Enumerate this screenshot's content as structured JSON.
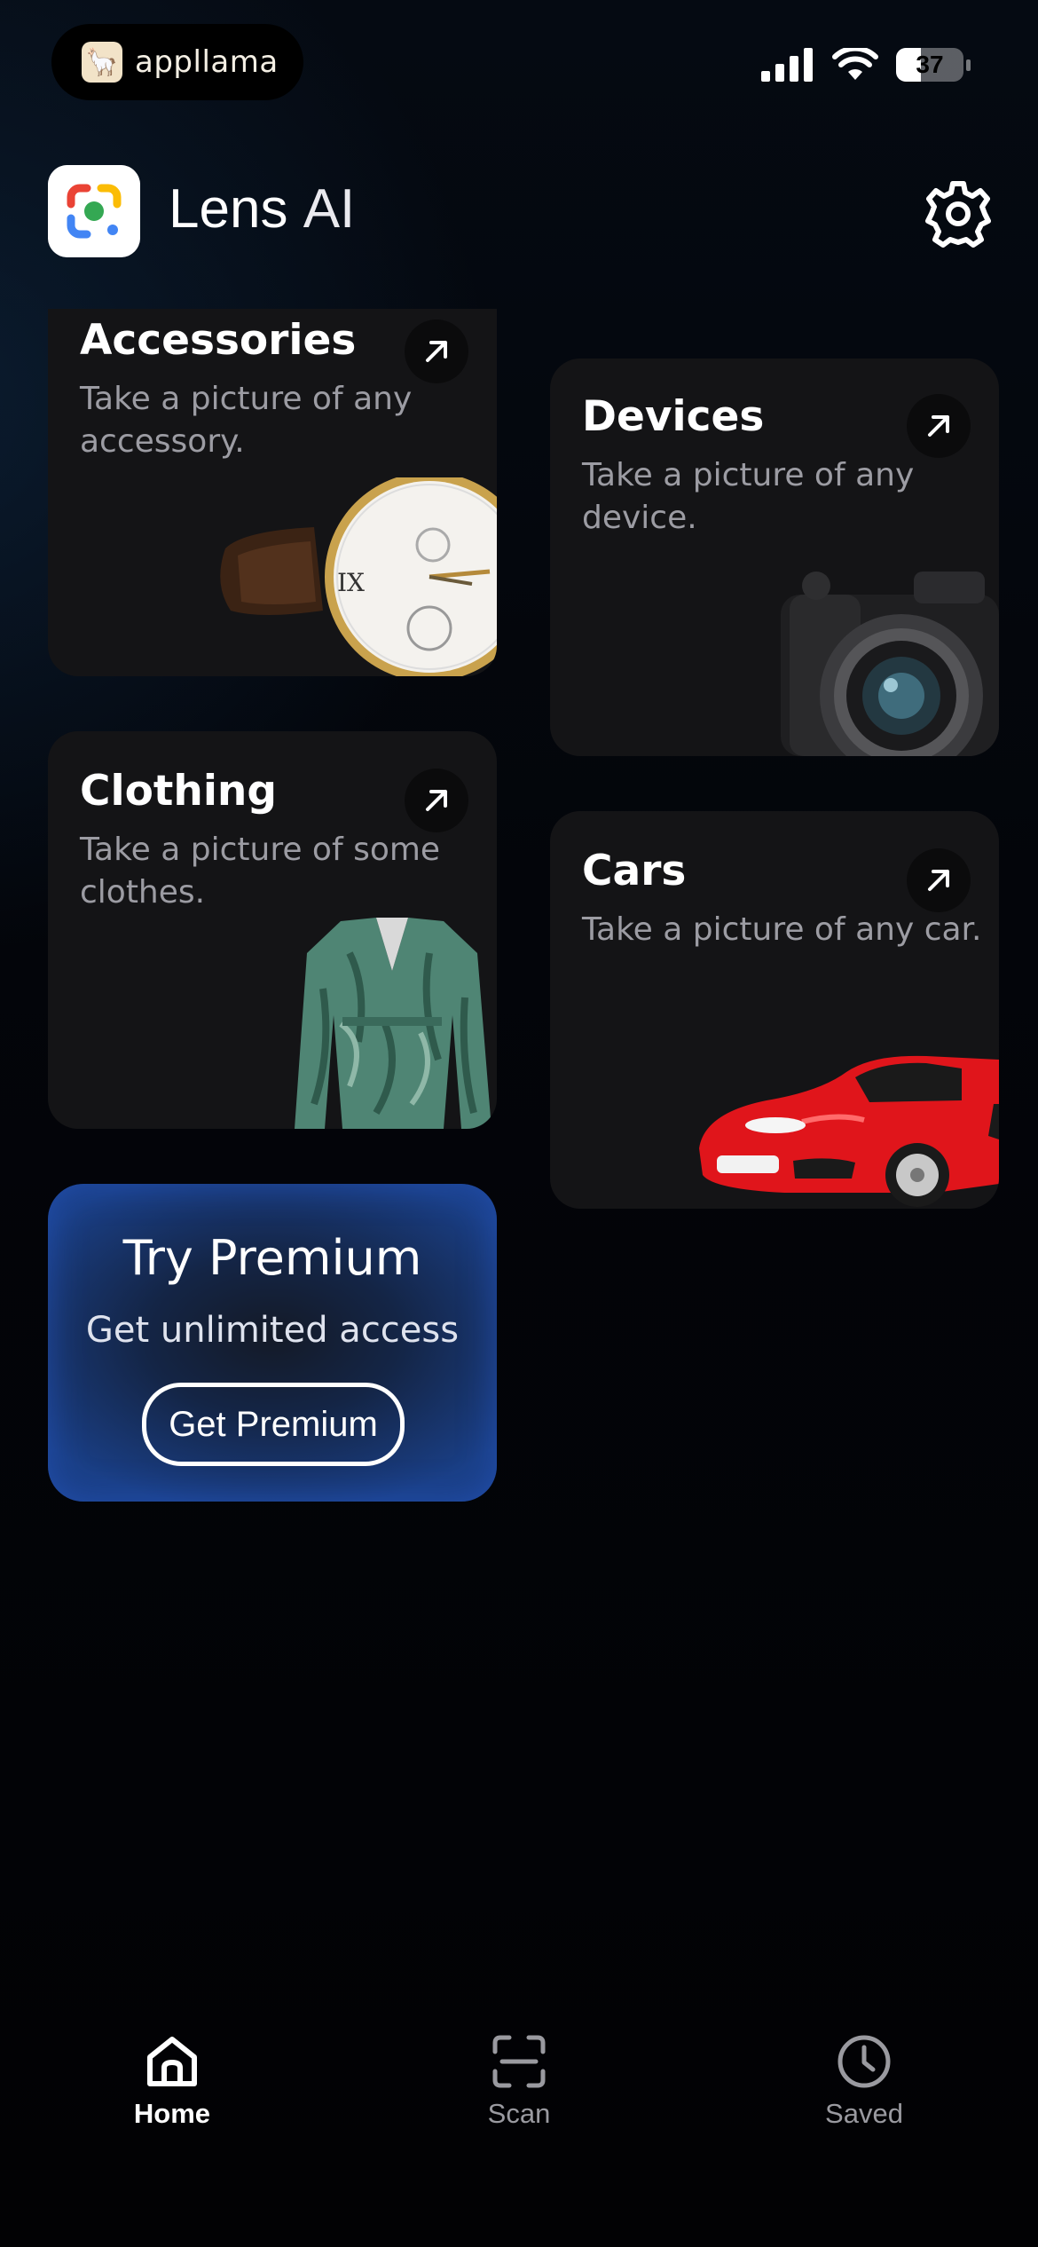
{
  "status_bar": {
    "carrier": "appllama",
    "battery": "37",
    "battery_level": 0.37
  },
  "header": {
    "title_main": "Lens",
    "title_accent": "AI"
  },
  "categories": [
    {
      "title": "Accessories",
      "description": "Take a picture of any accessory."
    },
    {
      "title": "Devices",
      "description": "Take a picture of any device."
    },
    {
      "title": "Clothing",
      "description": "Take a picture of some clothes."
    },
    {
      "title": "Cars",
      "description": "Take a picture of any car."
    }
  ],
  "premium": {
    "title": "Try Premium",
    "subtitle": "Get unlimited access",
    "button": "Get Premium"
  },
  "tabs": [
    {
      "label": "Home",
      "icon": "home-icon",
      "active": true
    },
    {
      "label": "Scan",
      "icon": "scan-icon",
      "active": false
    },
    {
      "label": "Saved",
      "icon": "clock-icon",
      "active": false
    }
  ],
  "colors": {
    "background": "#030306",
    "card": "#141416",
    "premium_edge": "#1a3f86",
    "muted_text": "#9c9ca3"
  }
}
